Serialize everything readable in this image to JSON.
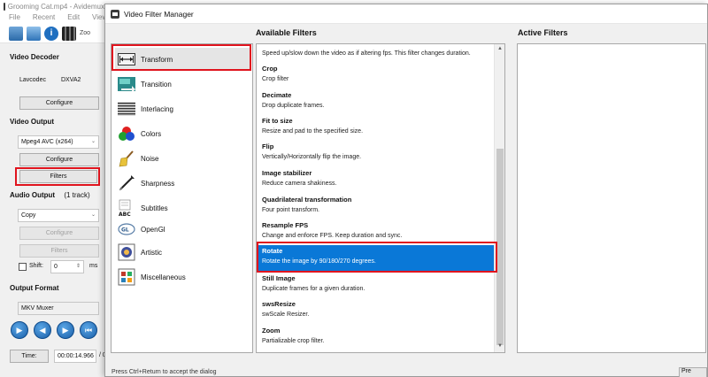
{
  "main": {
    "title": "Grooming Cat.mp4 - Avidemux",
    "menu": [
      "File",
      "Recent",
      "Edit",
      "View"
    ],
    "toolbar_zoom_label": "Zoo",
    "video_decoder": {
      "heading": "Video Decoder",
      "codec": "Lavcodec",
      "accel": "DXVA2",
      "configure_label": "Configure"
    },
    "video_output": {
      "heading": "Video Output",
      "codec_value": "Mpeg4 AVC (x264)",
      "configure_label": "Configure",
      "filters_label": "Filters"
    },
    "audio_output": {
      "heading": "Audio Output",
      "tracks": "(1 track)",
      "codec_value": "Copy",
      "configure_label": "Configure",
      "filters_label": "Filters",
      "shift_label": "Shift:",
      "shift_value": "0",
      "shift_unit": "ms"
    },
    "output_format": {
      "heading": "Output Format",
      "muxer_value": "MKV Muxer"
    },
    "time_label": "Time:",
    "time_value": "00:00:14.966",
    "time_sep": "/ 0"
  },
  "dialog": {
    "title": "Video Filter Manager",
    "categories": [
      {
        "label": "Transform",
        "icon": "transform-icon",
        "selected": true
      },
      {
        "label": "Transition",
        "icon": "transition-icon"
      },
      {
        "label": "Interlacing",
        "icon": "interlacing-icon"
      },
      {
        "label": "Colors",
        "icon": "colors-icon"
      },
      {
        "label": "Noise",
        "icon": "noise-icon"
      },
      {
        "label": "Sharpness",
        "icon": "sharpness-icon"
      },
      {
        "label": "Subtitles",
        "icon": "subtitles-icon"
      },
      {
        "label": "OpenGl",
        "icon": "opengl-icon"
      },
      {
        "label": "Artistic",
        "icon": "artistic-icon"
      },
      {
        "label": "Miscellaneous",
        "icon": "miscellaneous-icon"
      }
    ],
    "available_heading": "Available Filters",
    "active_heading": "Active Filters",
    "filters": [
      {
        "name": "",
        "desc": "Speed up/slow down the video as if altering fps. This filter changes duration."
      },
      {
        "name": "Crop",
        "desc": "Crop filter"
      },
      {
        "name": "Decimate",
        "desc": "Drop duplicate frames."
      },
      {
        "name": "Fit to size",
        "desc": "Resize and pad to the specified size."
      },
      {
        "name": "Flip",
        "desc": "Vertically/Horizontally flip the image."
      },
      {
        "name": "Image stabilizer",
        "desc": "Reduce camera shakiness."
      },
      {
        "name": "Quadrilateral transformation",
        "desc": "Four point transform."
      },
      {
        "name": "Resample FPS",
        "desc": "Change and enforce FPS. Keep duration and sync."
      },
      {
        "name": "Rotate",
        "desc": "Rotate the image by 90/180/270 degrees.",
        "selected": true
      },
      {
        "name": "Still Image",
        "desc": "Duplicate frames for a given duration."
      },
      {
        "name": "swsResize",
        "desc": "swScale Resizer."
      },
      {
        "name": "Zoom",
        "desc": "Partializable crop filter."
      }
    ],
    "status_text": "Press Ctrl+Return to accept the dialog",
    "preview_label": "Pre"
  },
  "colors": {
    "selection_blue": "#0a78d7",
    "highlight_red": "#e0141e"
  }
}
